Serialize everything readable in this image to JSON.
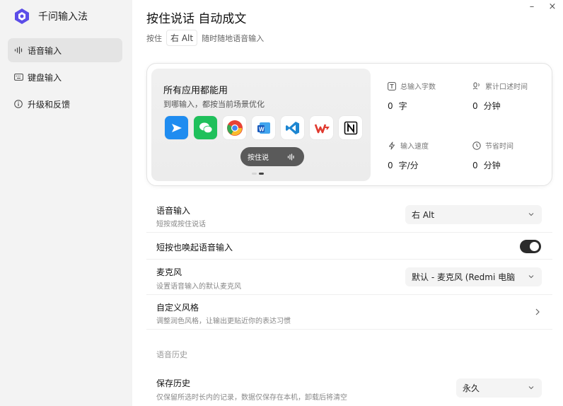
{
  "app": {
    "name": "千问输入法"
  },
  "sidebar": {
    "items": [
      {
        "label": "语音输入",
        "icon": "voice-wave-icon",
        "active": true
      },
      {
        "label": "键盘输入",
        "icon": "keyboard-icon",
        "active": false
      },
      {
        "label": "升级和反馈",
        "icon": "info-icon",
        "active": false
      }
    ]
  },
  "window": {
    "minimize": "–",
    "close": "×"
  },
  "header": {
    "title": "按住说话 自动成文",
    "sub_before": "按住",
    "hotkey": "右 Alt",
    "sub_after": "随时随地语音输入"
  },
  "promo": {
    "title": "所有应用都能用",
    "subtitle": "到哪输入，都按当前场景优化",
    "apps": [
      "feishu-app-icon",
      "wechat-app-icon",
      "chrome-app-icon",
      "word-app-icon",
      "vscode-app-icon",
      "wps-app-icon",
      "notion-app-icon"
    ],
    "hold_button": "按住说",
    "carousel": {
      "count": 2,
      "active": 1
    }
  },
  "stats": [
    {
      "label": "总输入字数",
      "value": "0",
      "unit": "字",
      "icon": "text-icon"
    },
    {
      "label": "累计口述时间",
      "value": "0",
      "unit": "分钟",
      "icon": "mic-talk-icon"
    },
    {
      "label": "输入速度",
      "value": "0",
      "unit": "字/分",
      "icon": "lightning-icon"
    },
    {
      "label": "节省时间",
      "value": "0",
      "unit": "分钟",
      "icon": "clock-icon"
    }
  ],
  "settings": {
    "voice_input": {
      "title": "语音输入",
      "desc": "短按或按住说话",
      "value": "右 Alt"
    },
    "short_press": {
      "title": "短按也唤起语音输入",
      "enabled": true
    },
    "microphone": {
      "title": "麦克风",
      "desc": "设置语音输入的默认麦克风",
      "value": "默认 - 麦克风 (Redmi 电脑"
    },
    "style": {
      "title": "自定义风格",
      "desc": "调整润色风格，让输出更贴近你的表达习惯"
    },
    "history_section": "语音历史",
    "keep_history": {
      "title": "保存历史",
      "desc": "仅保留所选时长内的记录，数据仅保存在本机，卸载后将清空",
      "value": "永久"
    }
  },
  "colors": {
    "accent": "#2b2b2b",
    "sidebar_bg": "#f3f3f3",
    "brand": "#5b4de8"
  }
}
